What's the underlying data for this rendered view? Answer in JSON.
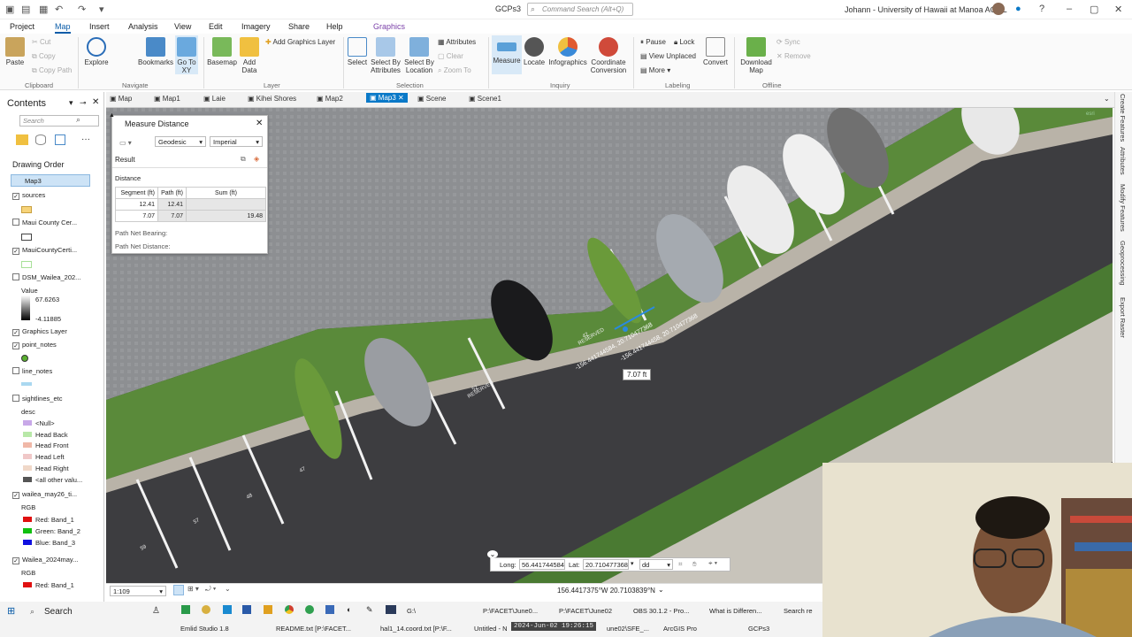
{
  "app": {
    "title": "GCPs3",
    "search_placeholder": "Command Search (Alt+Q)",
    "user": "Johann - University of Hawaii at Manoa AGOL"
  },
  "menu": {
    "items": [
      "Project",
      "Map",
      "Insert",
      "Analysis",
      "View",
      "Edit",
      "Imagery",
      "Share",
      "Help",
      "Graphics"
    ],
    "active": "Map"
  },
  "ribbon": {
    "clipboard": {
      "paste": "Paste",
      "cut": "Cut",
      "copy": "Copy",
      "copy_path": "Copy Path",
      "label": "Clipboard"
    },
    "navigate": {
      "explore": "Explore",
      "bookmarks": "Bookmarks",
      "go_to_xy": "Go To XY",
      "label": "Navigate"
    },
    "layer": {
      "basemap": "Basemap",
      "add_data": "Add Data",
      "add_graphics": "Add Graphics Layer",
      "label": "Layer"
    },
    "selection": {
      "select": "Select",
      "by_attr": "Select By Attributes",
      "by_loc": "Select By Location",
      "attributes": "Attributes",
      "clear": "Clear",
      "zoom_to": "Zoom To",
      "label": "Selection"
    },
    "inquiry": {
      "measure": "Measure",
      "locate": "Locate",
      "infographics": "Infographics",
      "coord_conv": "Coordinate Conversion",
      "label": "Inquiry"
    },
    "labeling": {
      "pause": "Pause",
      "lock": "Lock",
      "view_unplaced": "View Unplaced",
      "more": "More",
      "convert": "Convert",
      "label": "Labeling"
    },
    "offline": {
      "download_map": "Download Map",
      "sync": "Sync",
      "remove": "Remove",
      "label": "Offline"
    }
  },
  "contents": {
    "title": "Contents",
    "search_placeholder": "Search",
    "drawing_order": "Drawing Order",
    "map_name": "Map3",
    "layers": [
      {
        "name": "sources",
        "checked": true
      },
      {
        "name": "Maui County Cer...",
        "checked": false
      },
      {
        "name": "MauiCountyCerti...",
        "checked": true
      },
      {
        "name": "DSM_Wailea_202...",
        "checked": false,
        "legend_title": "Value",
        "max": "67.6263",
        "min": "-4.11885"
      },
      {
        "name": "Graphics Layer",
        "checked": true
      },
      {
        "name": "point_notes",
        "checked": true
      },
      {
        "name": "line_notes",
        "checked": false
      },
      {
        "name": "sightlines_etc",
        "checked": false,
        "field": "desc",
        "classes": [
          "<Null>",
          "Head Back",
          "Head Front",
          "Head Left",
          "Head Right",
          "<all other valu..."
        ]
      },
      {
        "name": "wailea_may26_ti...",
        "checked": true,
        "rgb": "RGB",
        "bands": [
          "Red:  Band_1",
          "Green: Band_2",
          "Blue:  Band_3"
        ]
      },
      {
        "name": "Wailea_2024may...",
        "checked": true,
        "rgb": "RGB",
        "bands": [
          "Red:  Band_1"
        ]
      }
    ]
  },
  "tabs": [
    "Map",
    "Map1",
    "Laie",
    "Kihei Shores",
    "Map2",
    "Map3",
    "Scene",
    "Scene1"
  ],
  "active_tab": "Map3",
  "measure": {
    "title": "Measure Distance",
    "mode": "Geodesic",
    "units": "Imperial",
    "result_label": "Result",
    "distance_label": "Distance",
    "headers": [
      "Segment (ft)",
      "Path (ft)",
      "Sum (ft)"
    ],
    "rows": [
      [
        "12.41",
        "12.41",
        ""
      ],
      [
        "7.07",
        "7.07",
        "19.48"
      ]
    ],
    "bearing_label": "Path Net Bearing:",
    "net_distance_label": "Path Net Distance:"
  },
  "map": {
    "measure_label": "7.07 ft",
    "coord_label_1": "-156.441744584, 20.710477368",
    "coord_label_2": "-156.441744458, 20.710477368",
    "stall_numbers": [
      "42",
      "52",
      "47",
      "48",
      "57",
      "59"
    ],
    "reserved_text": "RESERVED"
  },
  "coord_input": {
    "long_label": "Long:",
    "long_value": "56.441744584",
    "lat_label": "Lat:",
    "lat_value": "20.710477368",
    "format": "dd"
  },
  "status": {
    "scale": "1:109",
    "coordinates": "156.4417375°W 20.7103839°N"
  },
  "taskbar": {
    "search": "Search",
    "row1": [
      "G:\\",
      "P:\\FACET\\June0...",
      "P:\\FACET\\June02",
      "OBS 30.1.2 - Pro...",
      "What is Differen...",
      "Search re"
    ],
    "row2": [
      "Emlid Studio 1.8",
      "README.txt [P:\\FACET...",
      "hal1_14.coord.txt [P:\\F...",
      "Untitled - N",
      "2024-Jun-02 19:26:15",
      "une02\\SFE_...",
      "ArcGIS Pro",
      "GCPs3"
    ]
  },
  "right_panels": [
    "Create Features",
    "Attributes",
    "Modify Features",
    "Geoprocessing",
    "Export Raster"
  ]
}
